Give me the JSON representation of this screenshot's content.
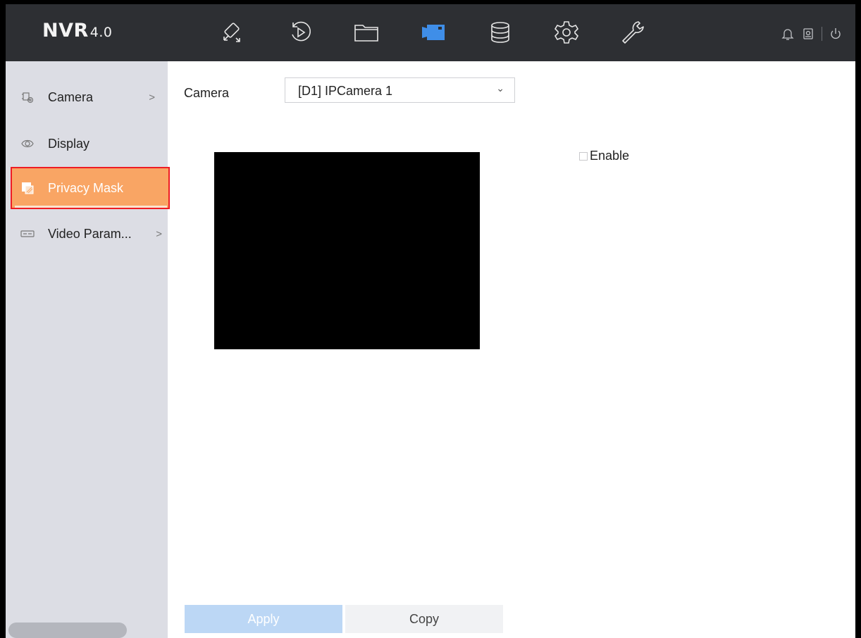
{
  "app": {
    "logo_main": "NVR",
    "logo_version": "4.0"
  },
  "nav": [
    {
      "name": "live-view-icon",
      "active": false
    },
    {
      "name": "playback-icon",
      "active": false
    },
    {
      "name": "file-management-icon",
      "active": false
    },
    {
      "name": "camera-icon",
      "active": true
    },
    {
      "name": "storage-icon",
      "active": false
    },
    {
      "name": "configuration-icon",
      "active": false
    },
    {
      "name": "maintenance-icon",
      "active": false
    }
  ],
  "header_right": [
    "alarm-bell-icon",
    "notification-icon",
    "power-icon"
  ],
  "sidebar": {
    "items": [
      {
        "label": "Camera",
        "icon": "camera-settings-icon",
        "has_chevron": true,
        "chevron": ">",
        "active": false
      },
      {
        "label": "Display",
        "icon": "eye-icon",
        "has_chevron": false,
        "active": false
      },
      {
        "label": "Privacy Mask",
        "icon": "privacy-mask-icon",
        "has_chevron": false,
        "active": true
      },
      {
        "label": "Video Param...",
        "icon": "video-param-icon",
        "has_chevron": true,
        "chevron": ">",
        "active": false
      }
    ]
  },
  "main": {
    "camera_label": "Camera",
    "camera_select_value": "[D1] IPCamera 1",
    "select_arrow": "⌄",
    "enable_label": "Enable",
    "enable_checked": false,
    "apply_label": "Apply",
    "copy_label": "Copy"
  },
  "colors": {
    "topbar": "#2d2f33",
    "accent_blue": "#3f8ee8",
    "sidebar_bg": "#dcdde4",
    "active_item": "#f9a564",
    "highlight_outline": "#ee1c24",
    "apply_button": "#bcd7f5"
  }
}
